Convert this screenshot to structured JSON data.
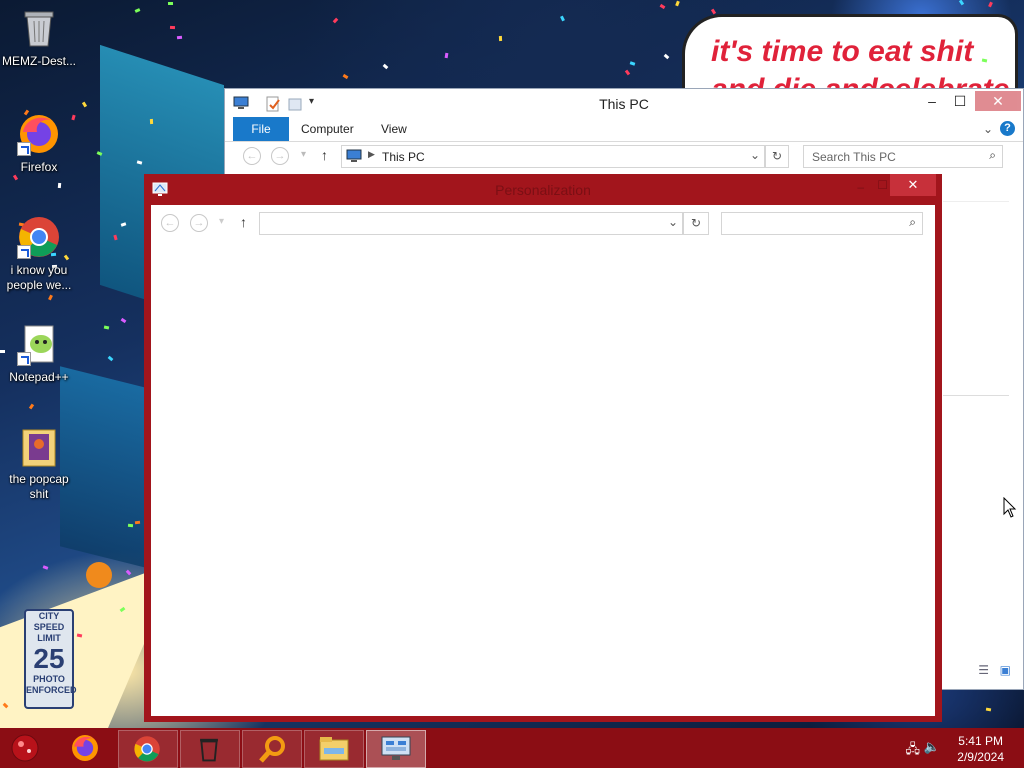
{
  "desktop": {
    "icons": [
      {
        "label": "MEMZ-Dest...",
        "icon": "recycle-bin-icon"
      },
      {
        "label": "Firefox",
        "icon": "firefox-icon"
      },
      {
        "label": "i know you people we...",
        "icon": "chrome-icon"
      },
      {
        "label": "Notepad++",
        "icon": "notepad-plus-plus-icon"
      },
      {
        "label": "the popcap shit",
        "icon": "folder-icon"
      }
    ],
    "banner_line1": "it's time to eat shit",
    "banner_line2": "and die andcelebrate",
    "sign": {
      "line1": "CITY",
      "line2": "SPEED",
      "line3": "LIMIT",
      "number": "25",
      "line4": "PHOTO",
      "line5": "ENFORCED"
    }
  },
  "explorer": {
    "title": "This PC",
    "tabs": {
      "file": "File",
      "computer": "Computer",
      "view": "View"
    },
    "address": "This PC",
    "search_placeholder": "Search This PC",
    "help": "?"
  },
  "personalization": {
    "title": "Personalization",
    "close": "✕"
  },
  "taskbar": {
    "time": "5:41 PM",
    "date": "2/9/2024",
    "apps": [
      "start-orb-icon",
      "firefox-icon",
      "chrome-icon",
      "recycle-bin-icon",
      "search-magnifier-icon",
      "file-explorer-icon",
      "control-panel-icon"
    ]
  },
  "colors": {
    "accent_red": "#a2151c",
    "taskbar": "#8b0d14",
    "file_tab": "#1979ca"
  }
}
